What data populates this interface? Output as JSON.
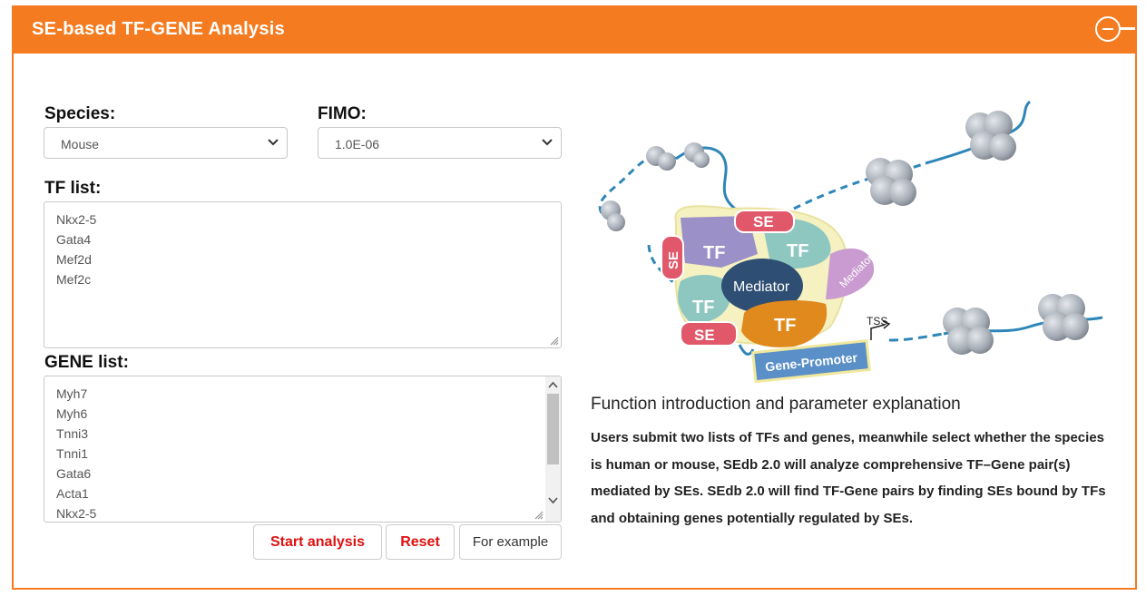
{
  "panel": {
    "title": "SE-based TF-GENE Analysis",
    "accent_color": "#f47b20"
  },
  "form": {
    "species": {
      "label": "Species:",
      "value": "Mouse"
    },
    "fimo": {
      "label": "FIMO:",
      "value": "1.0E-06"
    },
    "tf_list": {
      "label": "TF list:",
      "lines": [
        "Nkx2-5",
        "Gata4",
        "Mef2d",
        "Mef2c"
      ]
    },
    "gene_list": {
      "label": "GENE list:",
      "lines": [
        "Myh7",
        "Myh6",
        "Tnni3",
        "Tnni1",
        "Gata6",
        "Acta1",
        "Nkx2-5"
      ]
    },
    "buttons": {
      "start": "Start analysis",
      "reset": "Reset",
      "example": "For example"
    }
  },
  "diagram": {
    "labels": {
      "se": "SE",
      "tf": "TF",
      "mediator": "Mediator",
      "tss": "TSS",
      "gene_promoter": "Gene-Promoter"
    }
  },
  "function": {
    "title": "Function introduction and parameter explanation",
    "description": "Users submit two lists of TFs and genes, meanwhile select whether the species is human or mouse, SEdb 2.0 will analyze comprehensive TF–Gene pair(s) mediated by SEs. SEdb 2.0 will find TF-Gene pairs by finding SEs bound by TFs and obtaining genes potentially regulated by SEs."
  }
}
